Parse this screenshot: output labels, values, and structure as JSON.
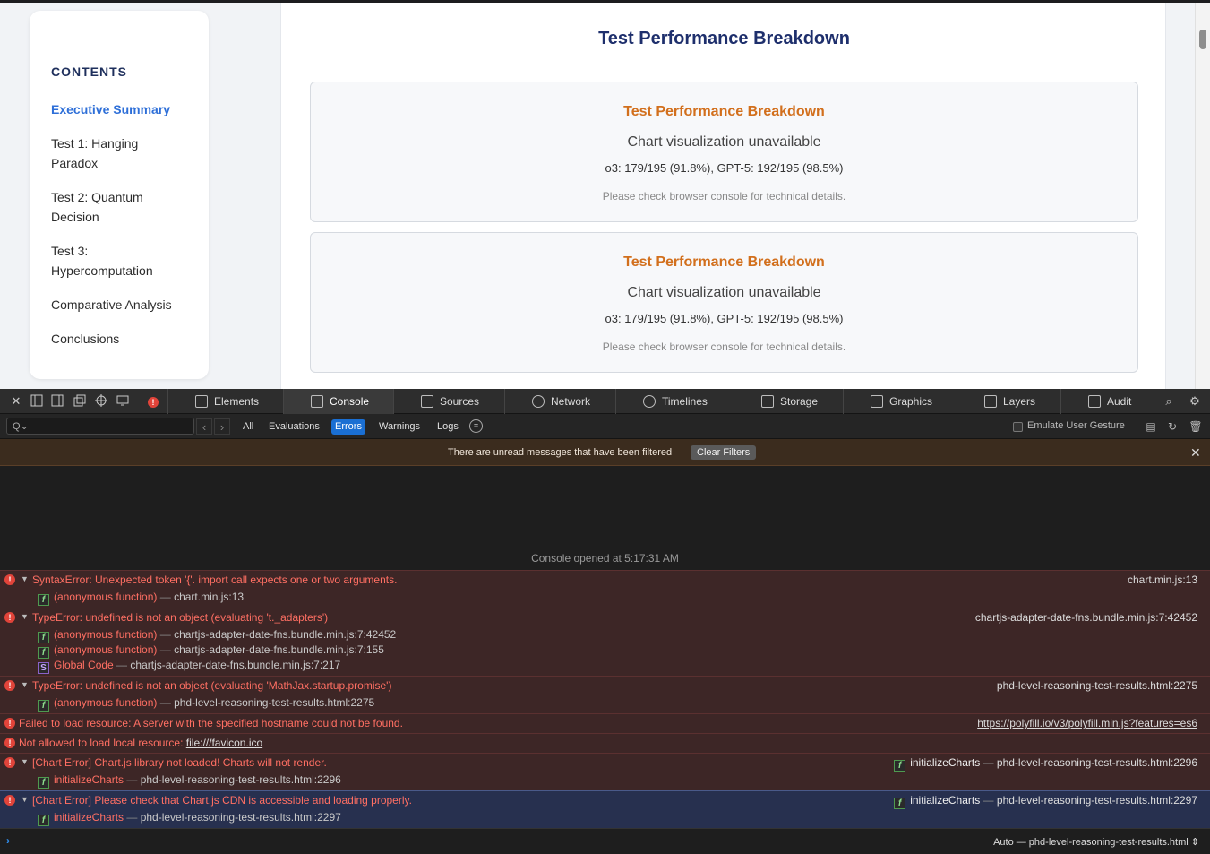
{
  "sidebar": {
    "title": "CONTENTS",
    "items": [
      {
        "label": "Executive Summary"
      },
      {
        "label": "Test 1: Hanging Paradox"
      },
      {
        "label": "Test 2: Quantum Decision"
      },
      {
        "label": "Test 3: Hypercomputation"
      },
      {
        "label": "Comparative Analysis"
      },
      {
        "label": "Conclusions"
      }
    ]
  },
  "main": {
    "title": "Test Performance Breakdown",
    "cards": [
      {
        "title": "Test Performance Breakdown",
        "unavailable": "Chart visualization unavailable",
        "stats": "o3: 179/195 (91.8%), GPT-5: 192/195 (98.5%)",
        "note": "Please check browser console for technical details."
      },
      {
        "title": "Test Performance Breakdown",
        "unavailable": "Chart visualization unavailable",
        "stats": "o3: 179/195 (91.8%), GPT-5: 192/195 (98.5%)",
        "note": "Please check browser console for technical details."
      }
    ]
  },
  "devtools": {
    "tabs": [
      "Elements",
      "Console",
      "Sources",
      "Network",
      "Timelines",
      "Storage",
      "Graphics",
      "Layers",
      "Audit"
    ],
    "active_tab": "Console",
    "filter_placeholder": "",
    "filters": [
      "All",
      "Evaluations",
      "Errors",
      "Warnings",
      "Logs"
    ],
    "active_filter": "Errors",
    "emulate_label": "Emulate User Gesture",
    "banner": {
      "text": "There are unread messages that have been filtered",
      "button": "Clear Filters"
    },
    "console_opened": "Console opened at 5:17:31 AM",
    "context": "Auto — phd-level-reasoning-test-results.html",
    "messages": [
      {
        "text": "SyntaxError: Unexpected token '{'. import call expects one or two arguments.",
        "source": "chart.min.js:13",
        "frames": [
          {
            "fn": "(anonymous function)",
            "sep": " — ",
            "file": "chart.min.js:13"
          }
        ]
      },
      {
        "text": "TypeError: undefined is not an object (evaluating 't._adapters')",
        "source": "chartjs-adapter-date-fns.bundle.min.js:7:42452",
        "frames": [
          {
            "fn": "(anonymous function)",
            "sep": " — ",
            "file": "chartjs-adapter-date-fns.bundle.min.js:7:42452"
          },
          {
            "fn": "(anonymous function)",
            "sep": " — ",
            "file": "chartjs-adapter-date-fns.bundle.min.js:7:155"
          },
          {
            "fn": "Global Code",
            "sep": " — ",
            "file": "chartjs-adapter-date-fns.bundle.min.js:7:217"
          }
        ]
      },
      {
        "text": "TypeError: undefined is not an object (evaluating 'MathJax.startup.promise')",
        "source": "phd-level-reasoning-test-results.html:2275",
        "frames": [
          {
            "fn": "(anonymous function)",
            "sep": " — ",
            "file": "phd-level-reasoning-test-results.html:2275"
          }
        ]
      },
      {
        "text": "Failed to load resource: A server with the specified hostname could not be found.",
        "source": "https://polyfill.io/v3/polyfill.min.js?features=es6"
      },
      {
        "text": "Not allowed to load local resource: ",
        "link": "file:///favicon.ico"
      },
      {
        "text": "[Chart Error] Chart.js library not loaded! Charts will not render.",
        "source_fn": "initializeCharts",
        "source_sep": " — ",
        "source": "phd-level-reasoning-test-results.html:2296",
        "frames": [
          {
            "fn": "initializeCharts",
            "sep": " — ",
            "file": "phd-level-reasoning-test-results.html:2296"
          }
        ]
      },
      {
        "text": "[Chart Error] Please check that Chart.js CDN is accessible and loading properly.",
        "source_fn": "initializeCharts",
        "source_sep": " — ",
        "source": "phd-level-reasoning-test-results.html:2297",
        "frames": [
          {
            "fn": "initializeCharts",
            "sep": " — ",
            "file": "phd-level-reasoning-test-results.html:2297"
          }
        ]
      }
    ]
  }
}
